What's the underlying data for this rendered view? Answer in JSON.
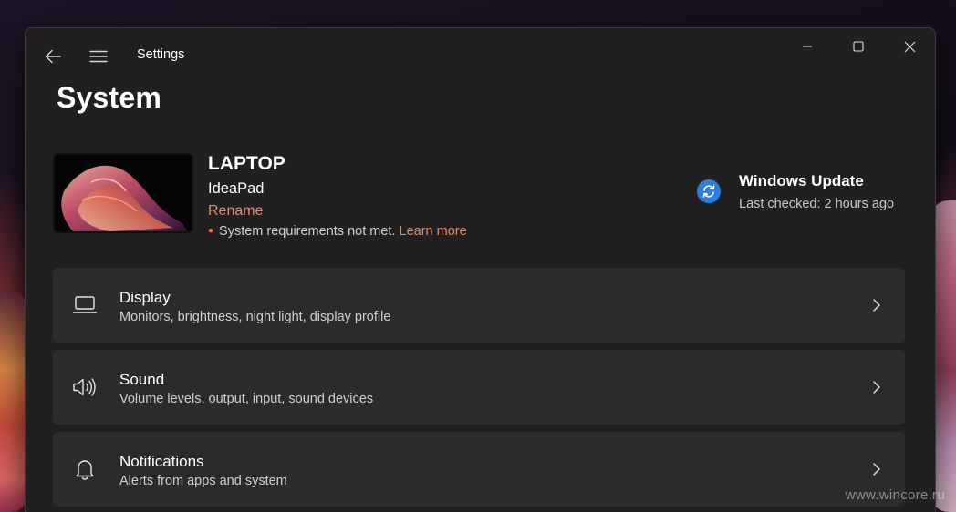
{
  "window": {
    "app_title": "Settings"
  },
  "page": {
    "title": "System"
  },
  "device": {
    "name": "LAPTOP",
    "model": "IdeaPad",
    "rename_label": "Rename",
    "requirements_text": "System requirements not met.",
    "learn_more_label": "Learn more"
  },
  "windows_update": {
    "title": "Windows Update",
    "subtitle": "Last checked: 2 hours ago"
  },
  "settings_items": [
    {
      "title": "Display",
      "subtitle": "Monitors, brightness, night light, display profile",
      "icon": "laptop-icon"
    },
    {
      "title": "Sound",
      "subtitle": "Volume levels, output, input, sound devices",
      "icon": "speaker-icon"
    },
    {
      "title": "Notifications",
      "subtitle": "Alerts from apps and system",
      "icon": "bell-icon"
    }
  ],
  "watermark": "www.wincore.ru",
  "colors": {
    "accent_link": "#e8896a",
    "update_icon_blue": "#2c7ee0",
    "window_bg": "#202020",
    "card_bg": "#2b2b2b"
  }
}
